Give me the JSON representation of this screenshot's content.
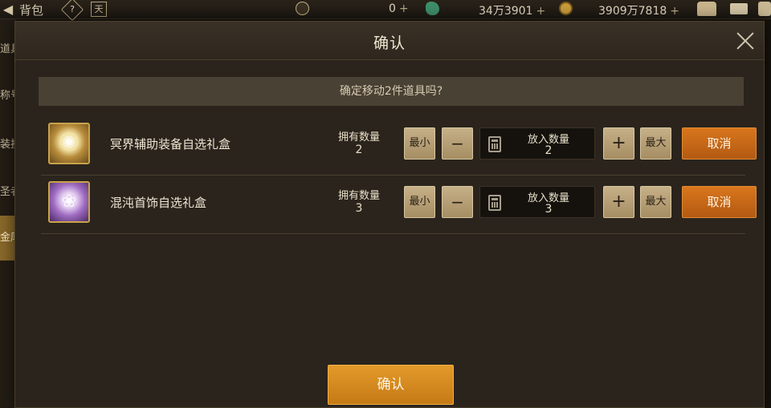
{
  "topbar": {
    "back_icon": "back-arrow-icon",
    "title": "背包",
    "help_glyph": "?",
    "calendar_glyph": "天",
    "currency1": {
      "value": "0",
      "icon": "coin-c-icon"
    },
    "currency2": {
      "value": "34万3901",
      "icon": "green-gem-icon"
    },
    "currency3": {
      "value": "3909万7818",
      "icon": "gold-coin-icon"
    },
    "plus": "+"
  },
  "left_rail": [
    "道具",
    "称号",
    "装扮",
    "圣者",
    "金库"
  ],
  "dialog": {
    "title": "确认",
    "notice": "确定移动2件道具吗?",
    "rows": [
      {
        "name": "冥界辅助装备自选礼盒",
        "own_label": "拥有数量",
        "own_value": "2",
        "qty_label": "放入数量",
        "qty_value": "2",
        "min_label": "最小",
        "minus_label": "−",
        "plus_label": "+",
        "max_label": "最大",
        "cancel_label": "取消",
        "icon_glyph": "✺"
      },
      {
        "name": "混沌首饰自选礼盒",
        "own_label": "拥有数量",
        "own_value": "3",
        "qty_label": "放入数量",
        "qty_value": "3",
        "min_label": "最小",
        "minus_label": "−",
        "plus_label": "+",
        "max_label": "最大",
        "cancel_label": "取消",
        "icon_glyph": "❀"
      }
    ],
    "confirm_label": "确认"
  },
  "colors": {
    "accent_orange": "#d9761d",
    "confirm_gold": "#e39a2a",
    "tan_button": "#c6b088"
  }
}
